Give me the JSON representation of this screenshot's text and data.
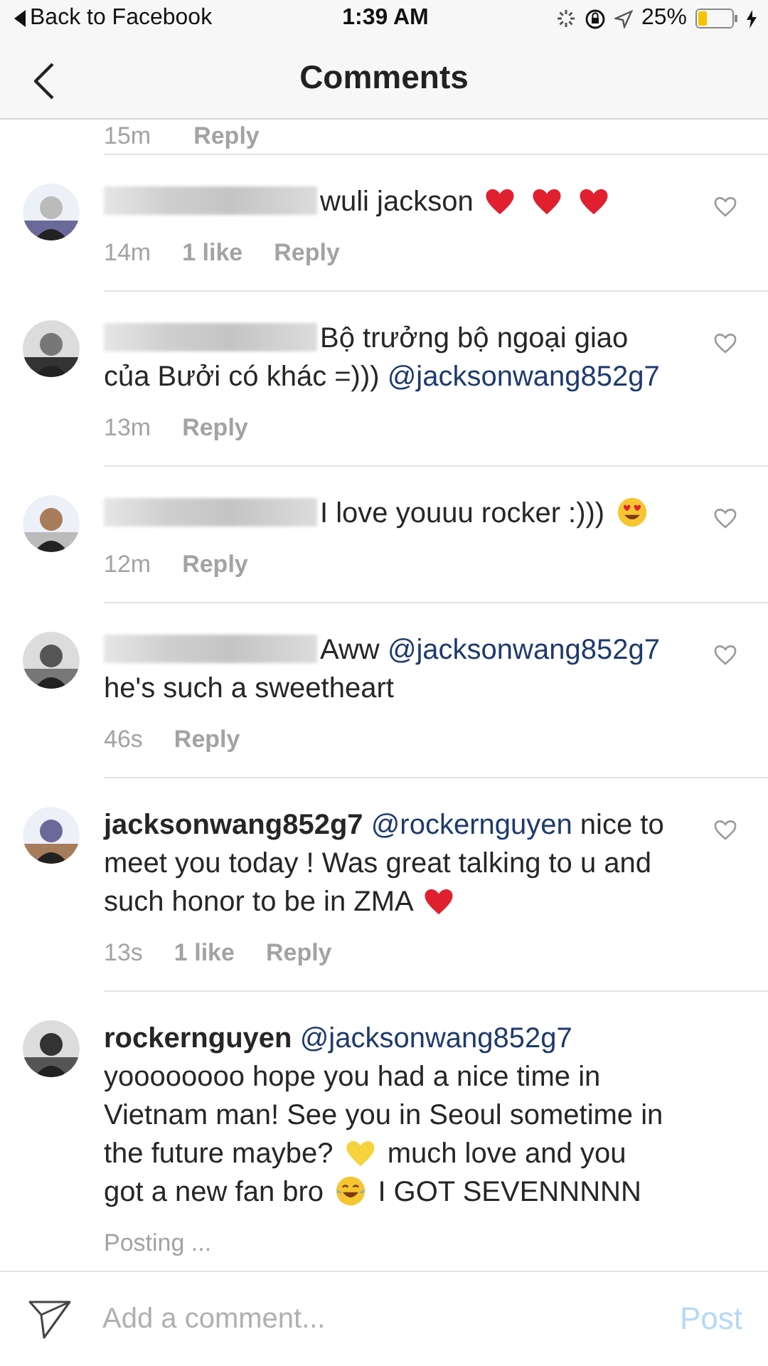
{
  "status_bar": {
    "back_app": "Back to Facebook",
    "time": "1:39 AM",
    "battery": "25%"
  },
  "header": {
    "title": "Comments"
  },
  "partial_row": {
    "time": "15m",
    "reply": "Reply"
  },
  "comments": [
    {
      "name_hidden": true,
      "body": [
        {
          "kind": "text",
          "text": "wuli jackson"
        },
        {
          "kind": "red-heart"
        },
        {
          "kind": "red-heart"
        },
        {
          "kind": "red-heart"
        }
      ],
      "time": "14m",
      "likes": "1 like",
      "reply": "Reply"
    },
    {
      "name_hidden": true,
      "body": [
        {
          "kind": "text",
          "text": "Bộ trưởng bộ ngoại giao của Bưởi có khác =)))"
        },
        {
          "kind": "mention",
          "text": "@jacksonwang852g7"
        }
      ],
      "time": "13m",
      "reply": "Reply"
    },
    {
      "name_hidden": true,
      "body": [
        {
          "kind": "text",
          "text": "I love youuu rocker :)))"
        },
        {
          "kind": "heart-eyes"
        }
      ],
      "time": "12m",
      "reply": "Reply"
    },
    {
      "name_hidden": true,
      "body": [
        {
          "kind": "text",
          "text": "Aww"
        },
        {
          "kind": "mention",
          "text": "@jacksonwang852g7"
        },
        {
          "kind": "text",
          "text": "he's such a sweetheart"
        }
      ],
      "time": "46s",
      "reply": "Reply"
    },
    {
      "name_hidden": false,
      "username": "jacksonwang852g7",
      "body": [
        {
          "kind": "mention",
          "text": "@rockernguyen"
        },
        {
          "kind": "text",
          "text": "nice to meet you today ! Was great talking to u and such honor to be in ZMA"
        },
        {
          "kind": "red-heart"
        }
      ],
      "time": "13s",
      "likes": "1 like",
      "reply": "Reply"
    },
    {
      "name_hidden": false,
      "username": "rockernguyen",
      "body": [
        {
          "kind": "mention",
          "text": "@jacksonwang852g7"
        },
        {
          "kind": "text",
          "text": "yoooooooo hope you had a nice time in Vietnam man! See you in Seoul sometime in the future maybe?"
        },
        {
          "kind": "yellow-heart"
        },
        {
          "kind": "text",
          "text": "much love and you got a new fan bro"
        },
        {
          "kind": "tears-of-joy"
        },
        {
          "kind": "text",
          "text": "I GOT SEVENNNNN"
        }
      ],
      "status": "Posting ..."
    }
  ],
  "composer": {
    "placeholder": "Add a comment...",
    "post": "Post",
    "disabled": true
  }
}
